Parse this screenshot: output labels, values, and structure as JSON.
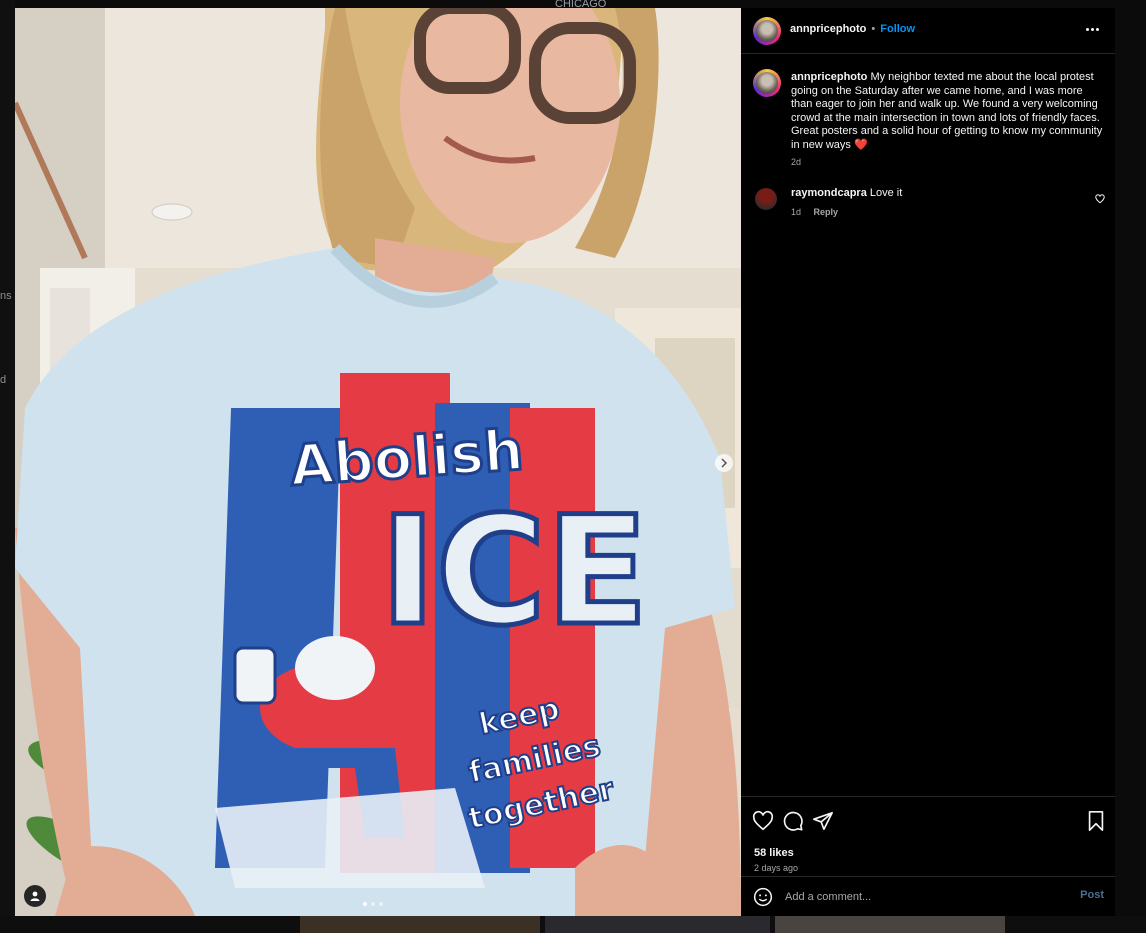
{
  "background": {
    "top_text": "CHICAGO",
    "left_fragments": [
      "ns",
      "d"
    ]
  },
  "post": {
    "username": "annpricephoto",
    "follow_label": "Follow",
    "separator": "•",
    "caption": "My neighbor texted me about the local protest going on the Saturday after we came home, and I was more than eager to join her and walk up. We found a very welcoming crowd at the main intersection in town and lots of friendly faces. Great posters and a solid hour of getting to know my community in new ways ❤️",
    "caption_age": "2d",
    "image": {
      "shirt_text_1": "Abolish",
      "shirt_text_2": "ICE",
      "shirt_text_3": "keep",
      "shirt_text_4": "families",
      "shirt_text_5": "together",
      "carousel_dots": 3,
      "active_dot": 1
    },
    "comments": [
      {
        "username": "raymondcapra",
        "text": "Love it",
        "age": "1d",
        "reply_label": "Reply"
      }
    ],
    "likes": "58 likes",
    "posted": "2 days ago",
    "add_comment_placeholder": "Add a comment...",
    "post_label": "Post"
  },
  "icons": [
    "more-icon",
    "next-icon",
    "tag-user-icon",
    "heart-icon",
    "comment-icon",
    "share-icon",
    "bookmark-icon",
    "emoji-icon"
  ],
  "colors": {
    "follow": "#0095f6",
    "post_disabled": "#4b6e8f",
    "panel_bg": "#000000",
    "divider": "#262626"
  }
}
